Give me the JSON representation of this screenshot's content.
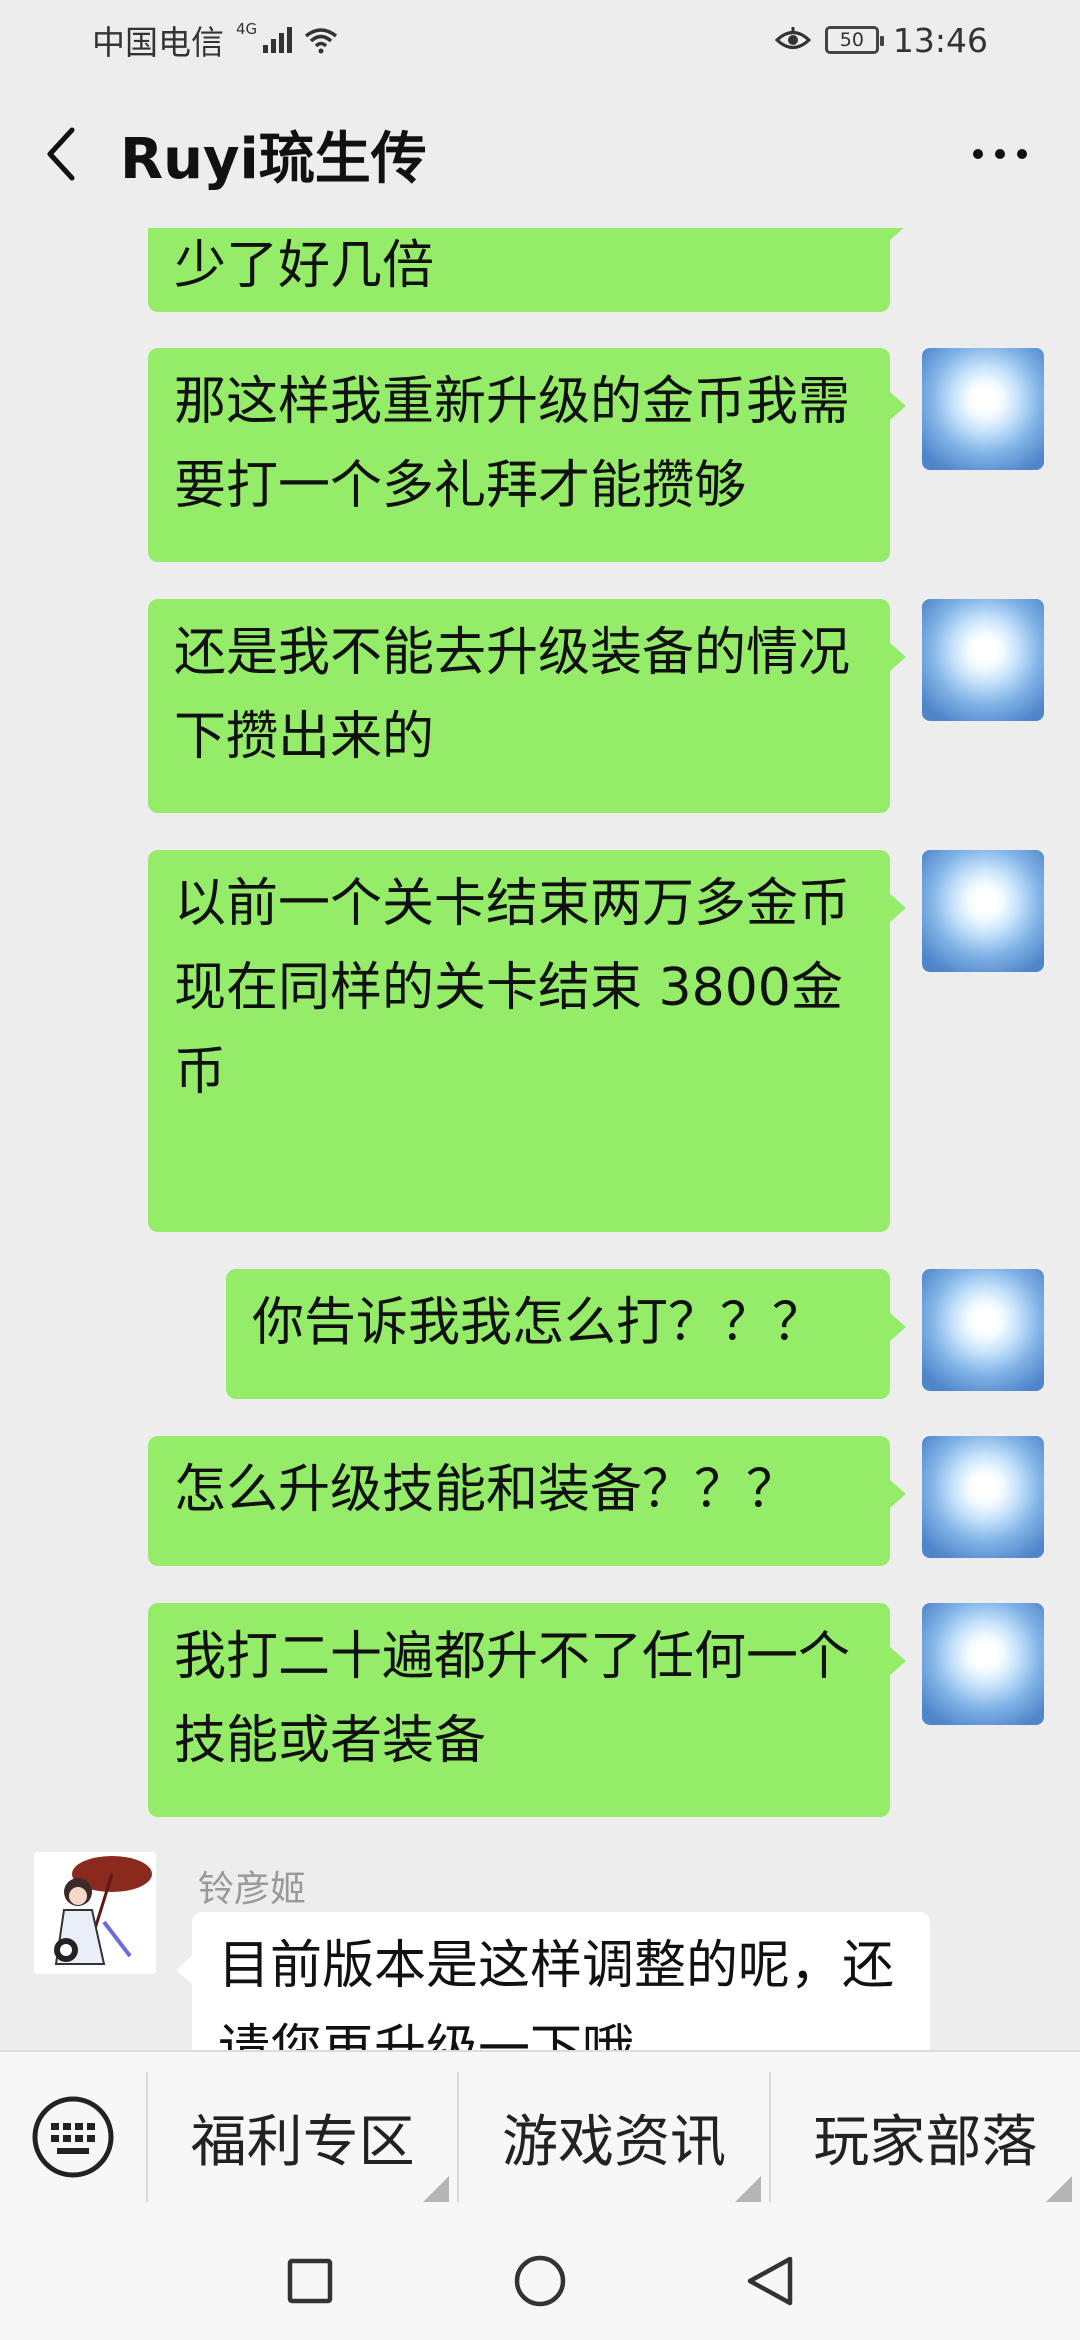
{
  "status_bar": {
    "carrier": "中国电信",
    "network": "4G",
    "battery": "50",
    "time": "13:46"
  },
  "header": {
    "title": "Ruyi琉生传"
  },
  "messages": [
    {
      "direction": "out",
      "text": "少了好几倍"
    },
    {
      "direction": "out",
      "text": "那这样我重新升级的金币我需要打一个多礼拜才能攒够"
    },
    {
      "direction": "out",
      "text": "还是我不能去升级装备的情况下攒出来的"
    },
    {
      "direction": "out",
      "text": "以前一个关卡结束两万多金币\n现在同样的关卡结束 3800金币"
    },
    {
      "direction": "out",
      "text": "你告诉我我怎么打？？？"
    },
    {
      "direction": "out",
      "text": "怎么升级技能和装备？？？"
    },
    {
      "direction": "out",
      "text": "我打二十遍都升不了任何一个技能或者装备"
    },
    {
      "direction": "in",
      "sender": "铃彦姬",
      "text": "目前版本是这样调整的呢，还请您再升级一下哦"
    }
  ],
  "bottom_menu": {
    "items": [
      "福利专区",
      "游戏资讯",
      "玩家部落"
    ]
  },
  "icons": {
    "back": "chevron-left-icon",
    "more": "more-dots-icon",
    "keyboard": "keyboard-icon",
    "nav_recent": "square-icon",
    "nav_home": "circle-icon",
    "nav_back": "triangle-back-icon"
  },
  "colors": {
    "outgoing_bubble": "#95ec69",
    "incoming_bubble": "#ffffff",
    "background": "#ededed"
  }
}
